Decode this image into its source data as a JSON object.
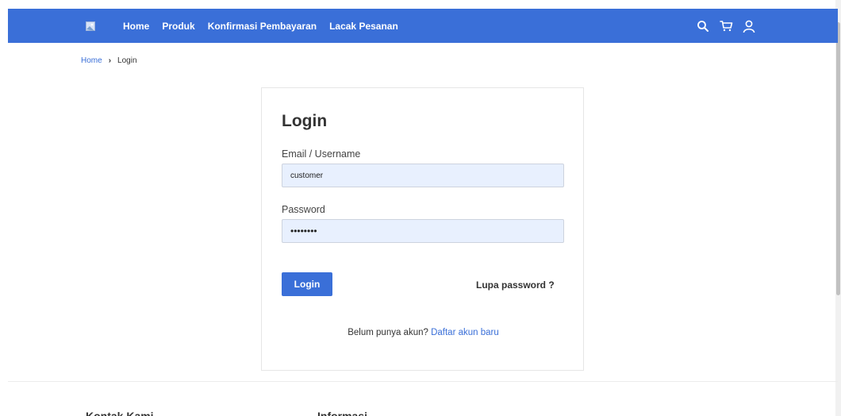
{
  "nav": {
    "links": [
      "Home",
      "Produk",
      "Konfirmasi Pembayaran",
      "Lacak Pesanan"
    ],
    "icons": [
      "search-icon",
      "cart-icon",
      "user-icon"
    ],
    "color": "#3a6fd8"
  },
  "breadcrumb": {
    "home": "Home",
    "separator": "›",
    "current": "Login"
  },
  "login": {
    "title": "Login",
    "email_label": "Email / Username",
    "email_value": "customer",
    "password_label": "Password",
    "password_value": "customer",
    "button": "Login",
    "forgot": "Lupa password ?",
    "register_text": "Belum punya akun?",
    "register_link": "Daftar akun baru"
  },
  "footer": {
    "col1": "Kontak Kami",
    "col2": "Informasi"
  }
}
